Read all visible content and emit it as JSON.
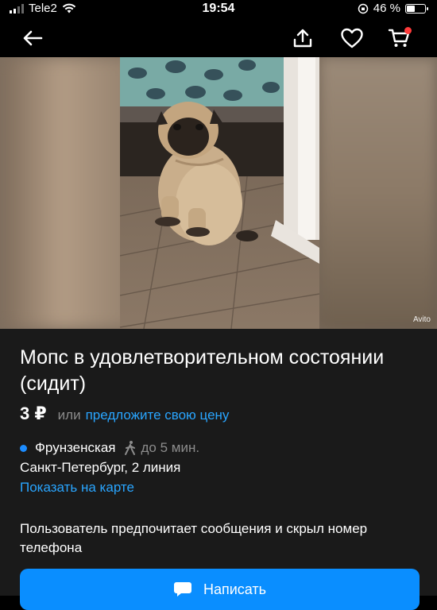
{
  "status_bar": {
    "carrier": "Tele2",
    "time": "19:54",
    "battery": "46 %",
    "battery_level": 0.46
  },
  "nav": {
    "back_icon": "arrow-left-icon",
    "share_icon": "share-icon",
    "favorite_icon": "heart-icon",
    "cart_icon": "cart-icon",
    "cart_badge_color": "#ff3b3b"
  },
  "gallery": {
    "watermark": "Avito"
  },
  "listing": {
    "title": "Мопс в удовлетворительном состоянии (сидит)",
    "price": "3 ₽",
    "price_or": "или",
    "offer_link": "предложите свою цену",
    "metro_station": "Фрунзенская",
    "walk_time": "до 5 мин.",
    "metro_color": "#1c8cff",
    "address": "Санкт-Петербург, 2 линия",
    "map_link": "Показать на карте",
    "seller_preference": "Пользователь предпочитает сообщения и скрыл номер телефона",
    "write_button": "Написать"
  },
  "colors": {
    "accent": "#0a8eff",
    "link": "#29a5ff",
    "background": "#1a1a1a"
  }
}
